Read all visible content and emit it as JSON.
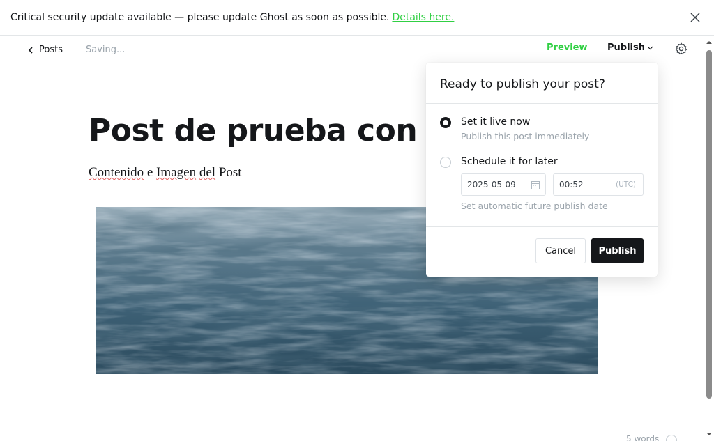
{
  "banner": {
    "message": "Critical security update available — please update Ghost as soon as possible.",
    "link": "Details here."
  },
  "header": {
    "back_label": "Posts",
    "status": "Saving...",
    "preview_label": "Preview",
    "publish_label": "Publish"
  },
  "post": {
    "title": "Post de prueba con Imagen",
    "body_words": [
      "Contenido",
      "e",
      "Imagen",
      "del",
      "Post"
    ]
  },
  "publish_menu": {
    "title": "Ready to publish your post?",
    "option_now": {
      "label": "Set it live now",
      "description": "Publish this post immediately",
      "selected": true
    },
    "option_schedule": {
      "label": "Schedule it for later",
      "date": "2025-05-09",
      "time": "00:52",
      "timezone": "(UTC)",
      "hint": "Set automatic future publish date",
      "selected": false
    },
    "cancel_label": "Cancel",
    "publish_label": "Publish"
  },
  "footer": {
    "word_count": "5 words"
  },
  "colors": {
    "accent_green": "#30cf43",
    "dark": "#15171a",
    "muted": "#9aa3ab"
  }
}
